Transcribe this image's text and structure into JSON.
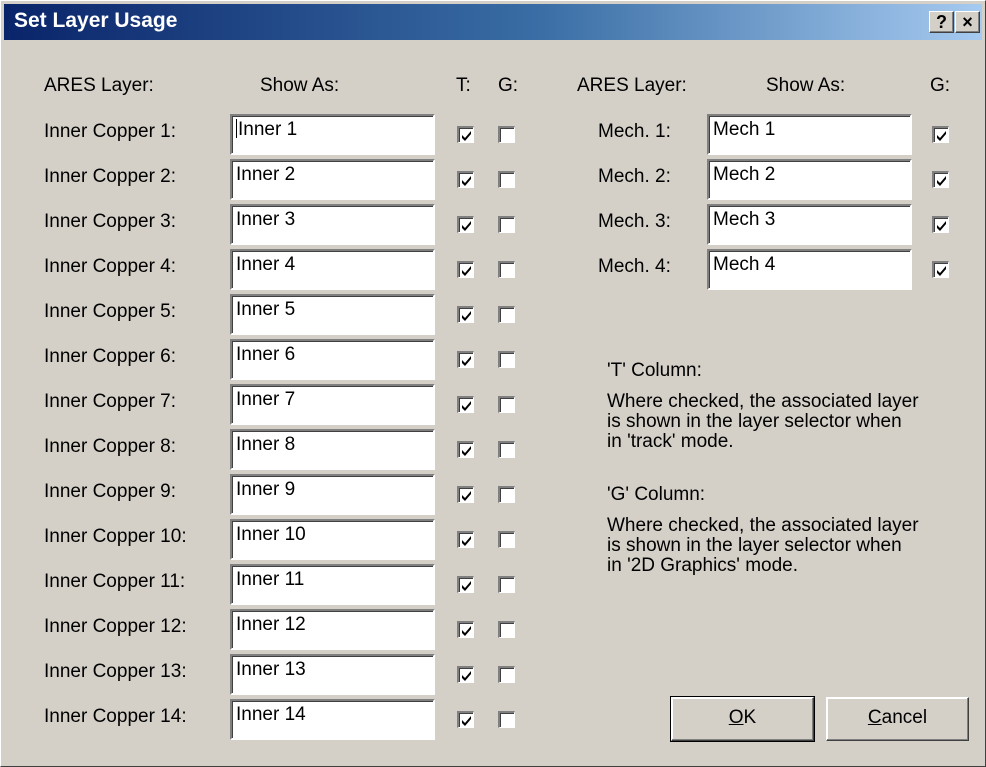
{
  "window": {
    "title": "Set Layer Usage",
    "help_label": "?",
    "close_label": "×"
  },
  "left_headers": {
    "ares_layer": "ARES Layer:",
    "show_as": "Show As:",
    "t": "T:",
    "g": "G:"
  },
  "right_headers": {
    "ares_layer": "ARES Layer:",
    "show_as": "Show As:",
    "g": "G:"
  },
  "inner_layers": [
    {
      "label": "Inner Copper 1:",
      "value": "Inner 1",
      "t": true,
      "g": false
    },
    {
      "label": "Inner Copper 2:",
      "value": "Inner 2",
      "t": true,
      "g": false
    },
    {
      "label": "Inner Copper 3:",
      "value": "Inner 3",
      "t": true,
      "g": false
    },
    {
      "label": "Inner Copper 4:",
      "value": "Inner 4",
      "t": true,
      "g": false
    },
    {
      "label": "Inner Copper 5:",
      "value": "Inner 5",
      "t": true,
      "g": false
    },
    {
      "label": "Inner Copper 6:",
      "value": "Inner 6",
      "t": true,
      "g": false
    },
    {
      "label": "Inner Copper 7:",
      "value": "Inner 7",
      "t": true,
      "g": false
    },
    {
      "label": "Inner Copper 8:",
      "value": "Inner 8",
      "t": true,
      "g": false
    },
    {
      "label": "Inner Copper 9:",
      "value": "Inner 9",
      "t": true,
      "g": false
    },
    {
      "label": "Inner Copper 10:",
      "value": "Inner 10",
      "t": true,
      "g": false
    },
    {
      "label": "Inner Copper 11:",
      "value": "Inner 11",
      "t": true,
      "g": false
    },
    {
      "label": "Inner Copper 12:",
      "value": "Inner 12",
      "t": true,
      "g": false
    },
    {
      "label": "Inner Copper 13:",
      "value": "Inner 13",
      "t": true,
      "g": false
    },
    {
      "label": "Inner Copper 14:",
      "value": "Inner 14",
      "t": true,
      "g": false
    }
  ],
  "mech_layers": [
    {
      "label": "Mech. 1:",
      "value": "Mech 1",
      "g": true
    },
    {
      "label": "Mech. 2:",
      "value": "Mech 2",
      "g": true
    },
    {
      "label": "Mech. 3:",
      "value": "Mech 3",
      "g": true
    },
    {
      "label": "Mech. 4:",
      "value": "Mech 4",
      "g": true
    }
  ],
  "info": {
    "t_heading": "'T' Column:",
    "t_body": [
      "Where checked, the associated layer",
      "is shown in the layer selector when",
      "in 'track' mode."
    ],
    "g_heading": "'G' Column:",
    "g_body": [
      "Where checked, the associated layer",
      "is shown in the layer selector when",
      "in '2D Graphics' mode."
    ]
  },
  "buttons": {
    "ok": {
      "mnemonic": "O",
      "rest": "K"
    },
    "cancel": {
      "mnemonic": "C",
      "rest": "ancel"
    }
  }
}
